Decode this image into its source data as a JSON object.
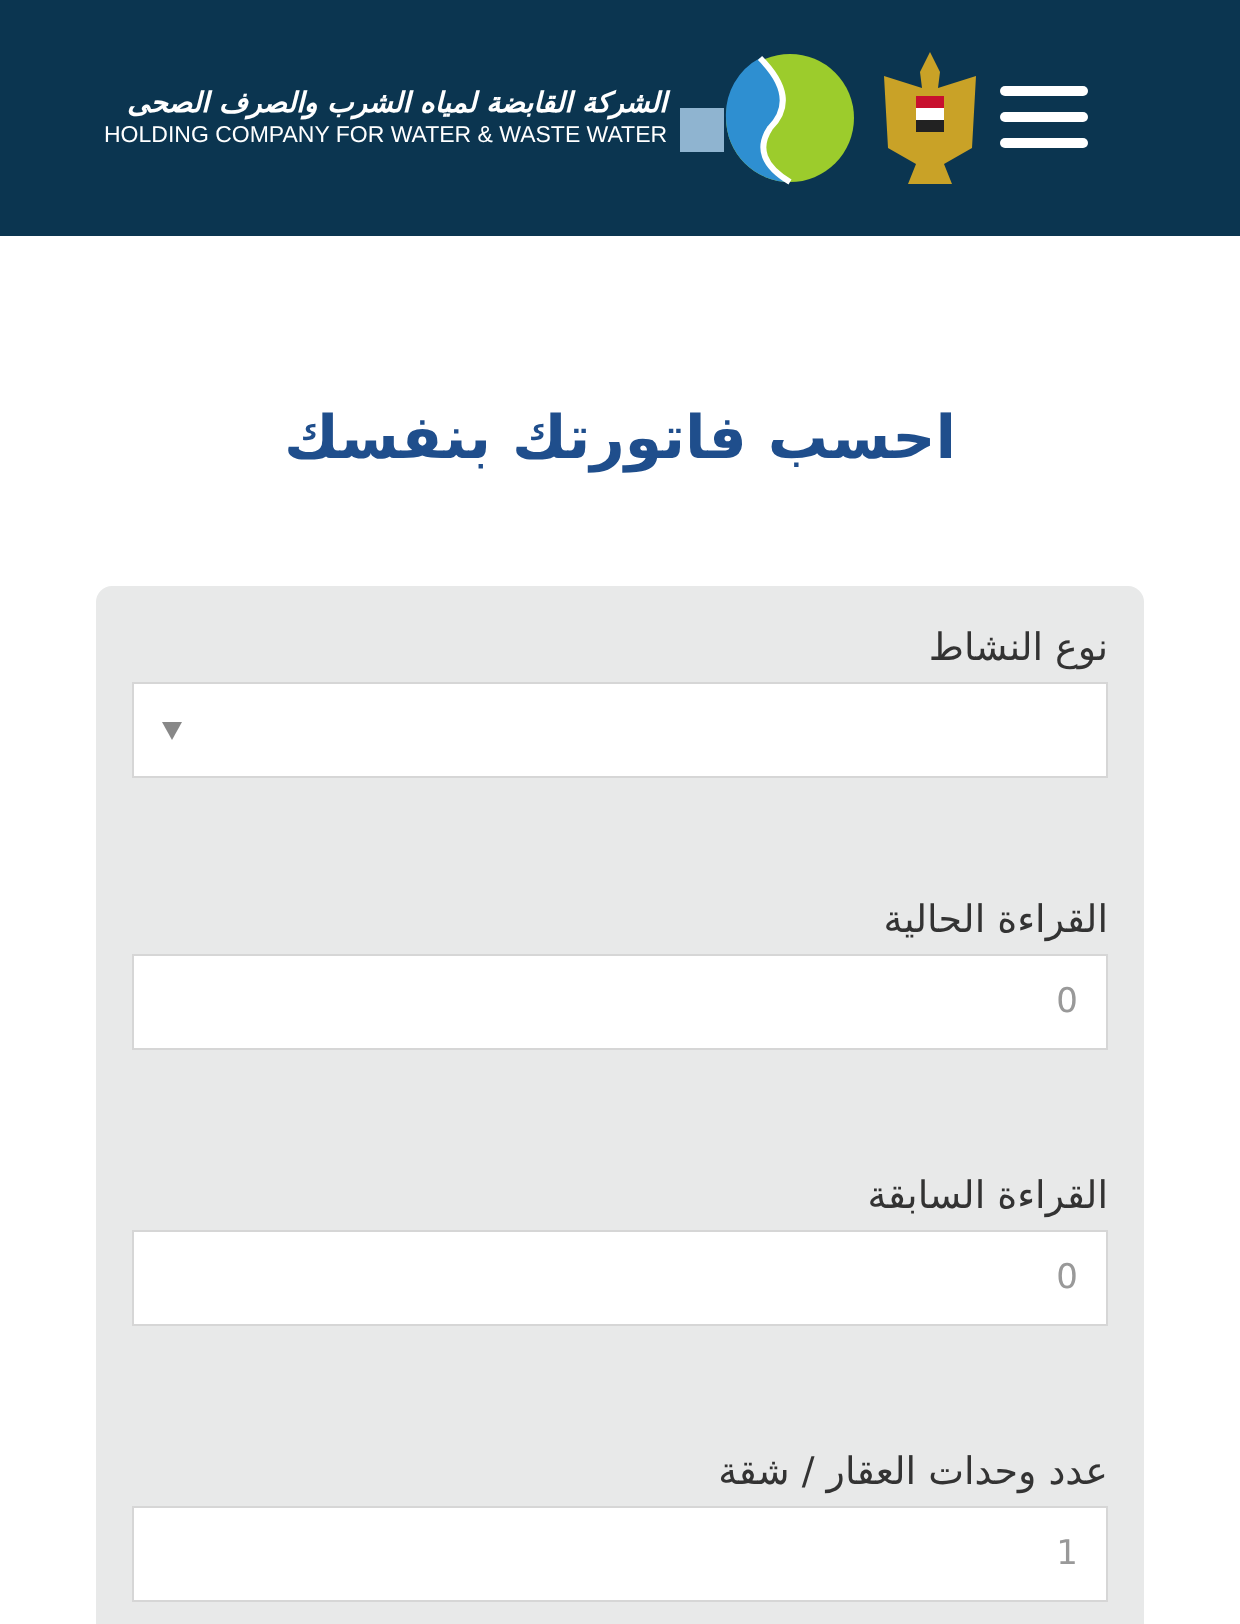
{
  "header": {
    "name_ar": "الشركة القابضة لمياه الشرب والصرف الصحى",
    "name_en": "HOLDING COMPANY FOR WATER & WASTE WATER"
  },
  "title": "احسب فاتورتك بنفسك",
  "form": {
    "fields": [
      {
        "kind": "select",
        "label": "نوع النشاط"
      },
      {
        "kind": "text",
        "label": "القراءة الحالية",
        "value": "0"
      },
      {
        "kind": "text",
        "label": "القراءة السابقة",
        "value": "0"
      },
      {
        "kind": "text",
        "label": "عدد وحدات العقار / شقة",
        "value": "1"
      }
    ]
  }
}
